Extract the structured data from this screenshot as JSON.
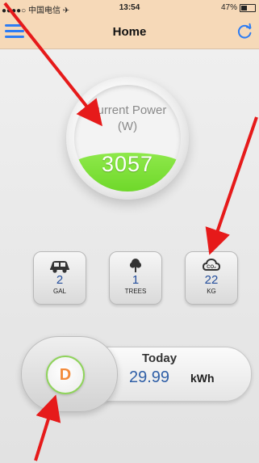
{
  "status_bar": {
    "carrier": "●●●●○ 中国电信 ✈",
    "time": "13:54",
    "battery": "47%"
  },
  "nav": {
    "title": "Home",
    "menu_icon": "hamburger-icon",
    "refresh_icon": "refresh-icon"
  },
  "gauge": {
    "label_line1": "Current Power",
    "label_line2": "(W)",
    "value": "3057",
    "fill_fraction": 0.36,
    "fill_color": "#7ddf37"
  },
  "eco": [
    {
      "icon": "car-icon",
      "value": "2",
      "unit": "GAL"
    },
    {
      "icon": "tree-icon",
      "value": "1",
      "unit": "TREES"
    },
    {
      "icon": "co2-cloud-icon",
      "value": "22",
      "unit": "KG"
    }
  ],
  "today": {
    "grade": "D",
    "label": "Today",
    "value": "29.99",
    "unit": "kWh"
  },
  "colors": {
    "nav_bg": "#f6d9b8",
    "accent_blue": "#2d7cf3",
    "annotation_red": "#e61a1a"
  }
}
